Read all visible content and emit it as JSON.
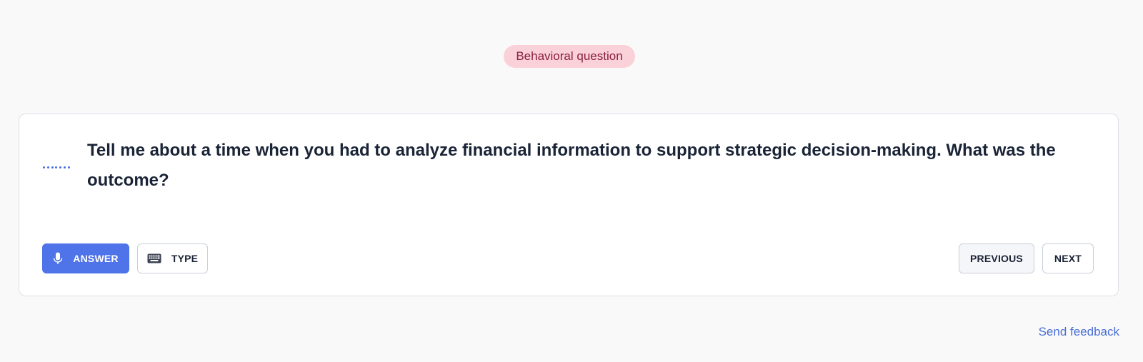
{
  "badge": {
    "label": "Behavioral question",
    "bg_color": "#fbd1d9",
    "text_color": "#8a1f3f"
  },
  "question": {
    "text": "Tell me about a time when you had to analyze financial information to support strategic decision-making. What was the outcome?"
  },
  "actions": {
    "answer_label": "ANSWER",
    "answer_icon": "microphone-icon",
    "type_label": "TYPE",
    "type_icon": "keyboard-icon"
  },
  "navigation": {
    "previous_label": "PREVIOUS",
    "next_label": "NEXT"
  },
  "footer": {
    "feedback_label": "Send feedback"
  },
  "colors": {
    "accent": "#4f73e8",
    "text": "#1a2436",
    "background": "#f9f9f9",
    "link": "#4a6fd6"
  }
}
